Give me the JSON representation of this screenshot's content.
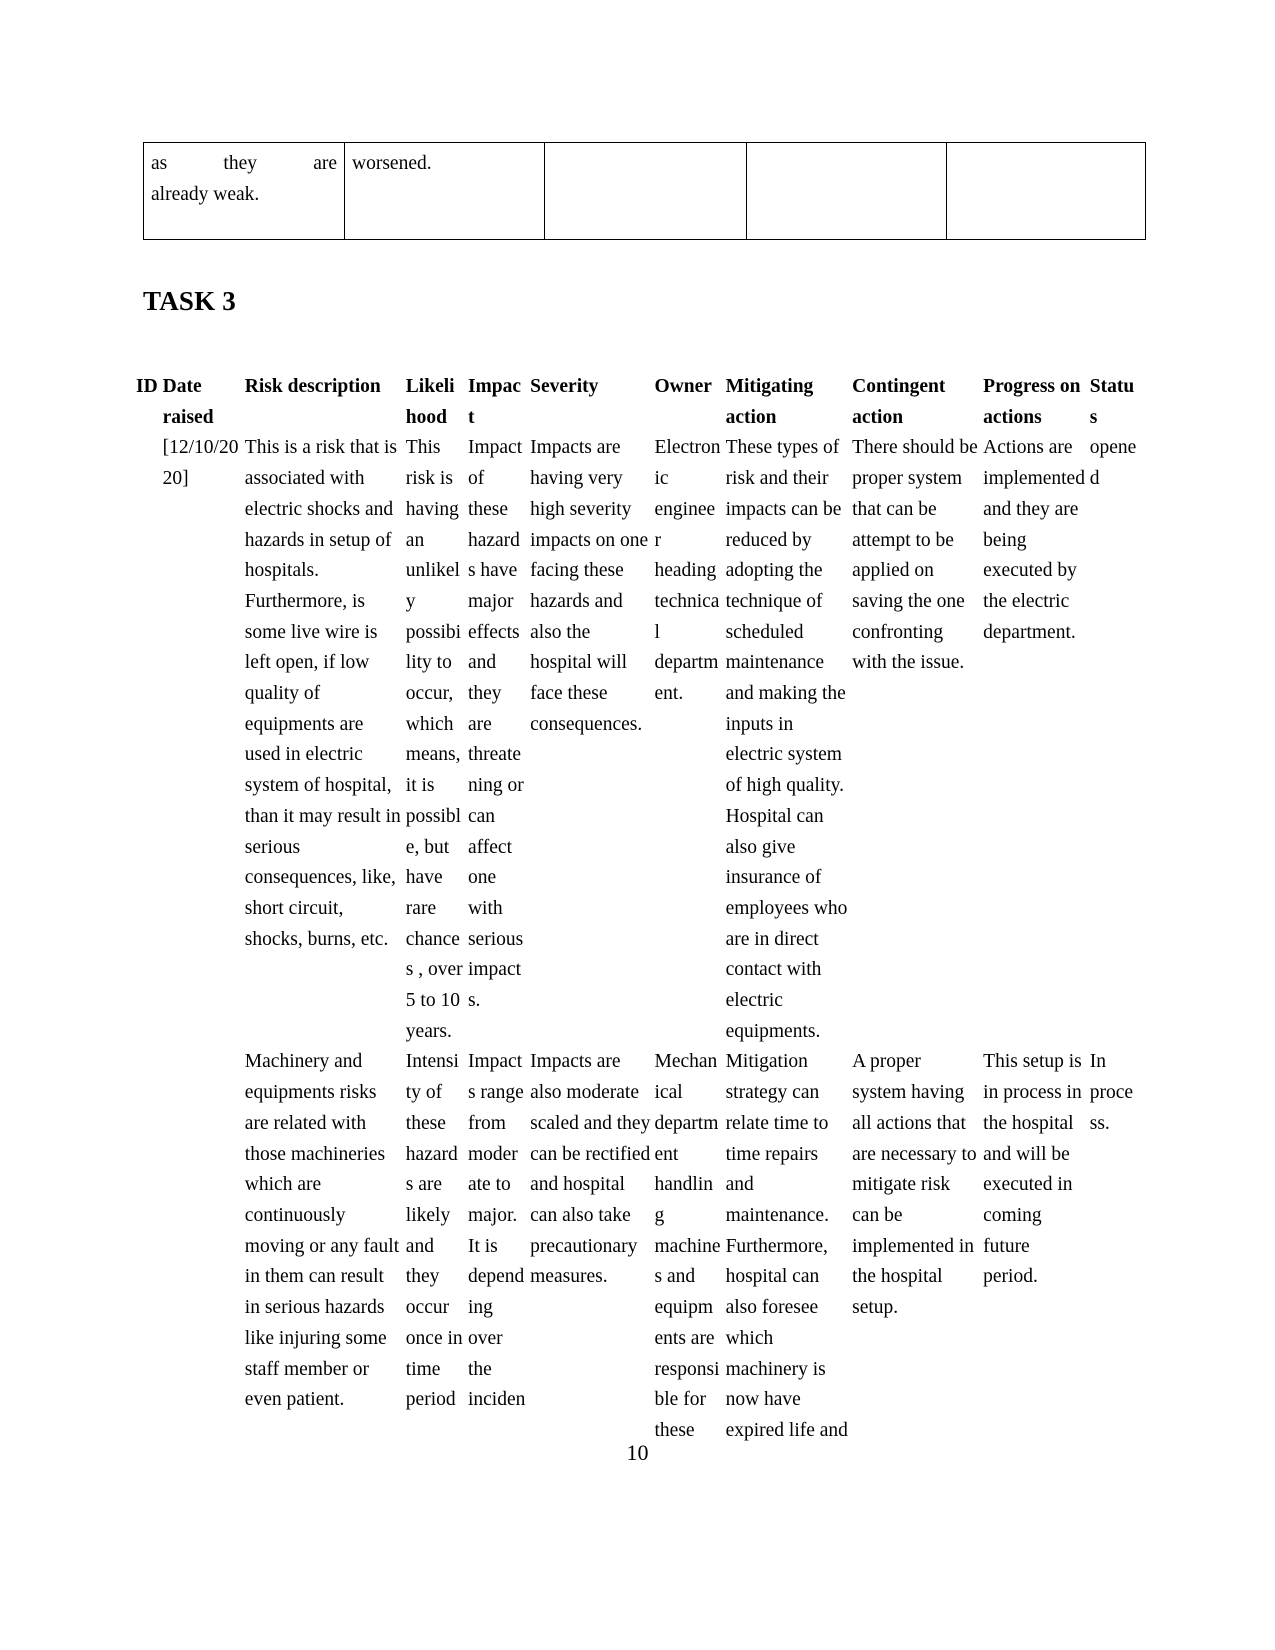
{
  "continuation_table": {
    "rows": [
      {
        "cells": [
          {
            "text": "as they are already weak.",
            "justified": true,
            "first_line": "as they are",
            "last_line": "already weak."
          },
          {
            "text": "worsened.",
            "justified": false
          },
          {
            "text": "",
            "justified": false
          },
          {
            "text": "",
            "justified": false
          },
          {
            "text": "",
            "justified": false
          }
        ]
      }
    ]
  },
  "heading": {
    "task_title": "TASK 3"
  },
  "risk_table": {
    "headers": [
      "ID",
      "Date raised",
      "Risk description",
      "Likelihood",
      "Impact",
      "Severity",
      "Owner",
      "Mitigating action",
      "Contingent action",
      "Progress on actions",
      "Status"
    ],
    "rows": [
      {
        "id": "",
        "date_raised": "[12/10/2020]",
        "risk_description": "This is a risk that is associated with electric shocks and hazards in setup of hospitals. Furthermore, is some live wire is left open, if low quality of equipments are used in electric system of hospital, than it may result in serious consequences, like, short circuit, shocks, burns, etc.",
        "likelihood": "This risk is having an unlikely possibility to occur, which means, it is possible, but have rare chances , over 5 to 10 years.",
        "impact": "Impact of these hazards have major effects and they are threatening or can affect one with serious impacts.",
        "severity": "Impacts are having very high severity impacts on one facing these hazards and also the hospital will face these consequences.",
        "owner": "Electronic engineer heading technical department.",
        "mitigating_action": "These types of risk and their impacts can be reduced by adopting the technique of scheduled maintenance and making the inputs in electric system of high quality. Hospital can also give insurance of employees who are in direct contact with electric equipments.",
        "contingent_action": "There should be proper system that can be attempt to be applied on saving the one confronting with the issue.",
        "progress_on_actions": "Actions are implemented and they are being executed by the electric department.",
        "status": "opened"
      },
      {
        "id": "",
        "date_raised": "",
        "risk_description": "Machinery and equipments risks are related with those machineries which are continuously moving or any fault in them can result in serious hazards like injuring some staff member or even patient.",
        "likelihood": "Intensity of these hazards are likely and they occur once in time period",
        "impact": "Impacts range from moderate to major. It is depending over the inciden",
        "severity": "Impacts are also moderate scaled and they can be rectified and hospital can also take precautionary measures.",
        "owner": "Mechanical department handling machines and equipments are responsible for these",
        "mitigating_action": "Mitigation strategy can relate time to time repairs and maintenance. Furthermore, hospital can also foresee which machinery is now have expired life and",
        "contingent_action": "A proper system having all actions that are necessary to mitigate risk can be implemented in the hospital setup.",
        "progress_on_actions": "This setup is in process in the hospital and will be executed in coming future period.",
        "status": "In process."
      }
    ]
  },
  "footer": {
    "page_number": "10"
  }
}
